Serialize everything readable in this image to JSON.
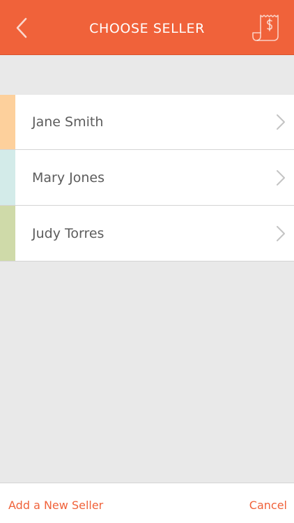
{
  "header": {
    "title": "CHOOSE SELLER",
    "back_icon": "chevron-left-icon",
    "action_icon": "receipt-dollar-icon",
    "color": "#f0623a"
  },
  "sellers": [
    {
      "name": "Jane Smith",
      "color": "#fdd09c"
    },
    {
      "name": "Mary Jones",
      "color": "#d3ebe9"
    },
    {
      "name": "Judy Torres",
      "color": "#cfdaa9"
    }
  ],
  "footer": {
    "add_label": "Add a New Seller",
    "cancel_label": "Cancel"
  }
}
